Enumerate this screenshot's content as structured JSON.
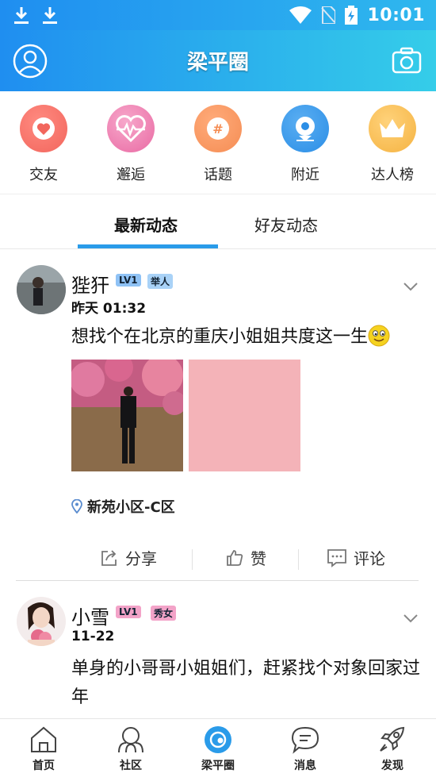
{
  "status_bar": {
    "time": "10:01",
    "icons": [
      "download-icon",
      "download-icon",
      "wifi-icon",
      "no-sim-icon",
      "battery-charging-icon"
    ]
  },
  "app_bar": {
    "title": "梁平圈",
    "left_icon": "user-avatar-icon",
    "right_icon": "camera-icon"
  },
  "categories": [
    {
      "label": "交友",
      "icon": "heart-icon",
      "color": "#f2665d"
    },
    {
      "label": "邂逅",
      "icon": "heartbeat-icon",
      "color": "#f27fa6"
    },
    {
      "label": "话题",
      "icon": "hashtag-icon",
      "color": "#f58d54"
    },
    {
      "label": "附近",
      "icon": "location-icon",
      "color": "#2b8ee6"
    },
    {
      "label": "达人榜",
      "icon": "crown-icon",
      "color": "#f5b342"
    }
  ],
  "feed_tabs": [
    {
      "label": "最新动态",
      "active": true
    },
    {
      "label": "好友动态",
      "active": false
    }
  ],
  "posts": [
    {
      "name": "狴犴",
      "level": "LV1",
      "tag": "举人",
      "time": "昨天 01:32",
      "text": "想找个在北京的重庆小姐姐共度这一生",
      "emoji": "smile-emoji-icon",
      "location": "新苑小区-C区",
      "actions": {
        "share": "分享",
        "like": "赞",
        "comment": "评论"
      }
    },
    {
      "name": "小雪",
      "level": "LV1",
      "tag": "秀女",
      "time": "11-22",
      "text": "单身的小哥哥小姐姐们，赶紧找个对象回家过年"
    }
  ],
  "bottom_nav": [
    {
      "label": "首页",
      "icon": "home-icon"
    },
    {
      "label": "社区",
      "icon": "community-icon"
    },
    {
      "label": "梁平圈",
      "icon": "circle-icon",
      "active": true
    },
    {
      "label": "消息",
      "icon": "message-icon"
    },
    {
      "label": "发现",
      "icon": "rocket-icon"
    }
  ],
  "colors": {
    "primary": "#1f8ef0",
    "accent": "#2a9be9",
    "level_badge": "#8fc2f5",
    "tag_male": "#a9d2f7",
    "tag_female": "#f3a3c8"
  }
}
